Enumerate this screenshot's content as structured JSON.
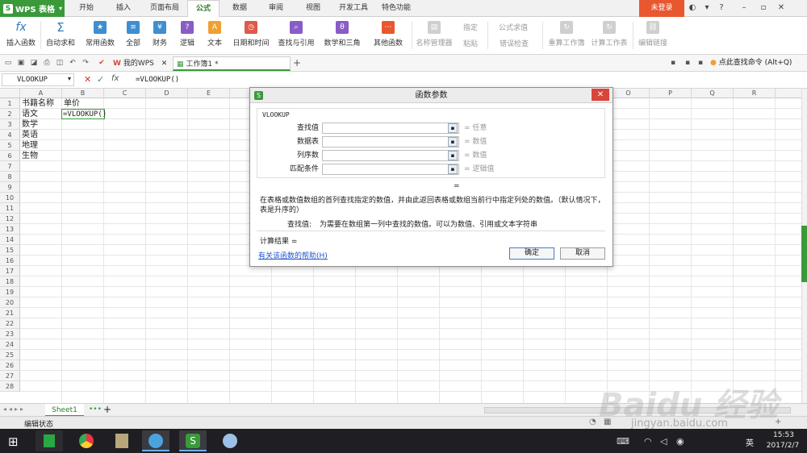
{
  "app": {
    "name": "WPS 表格"
  },
  "menu": {
    "tabs": [
      "开始",
      "插入",
      "页面布局",
      "公式",
      "数据",
      "审阅",
      "视图",
      "开发工具",
      "特色功能"
    ],
    "active": "公式",
    "login": "未登录"
  },
  "ribbon": {
    "items": [
      "插入函数",
      "自动求和",
      "常用函数",
      "全部",
      "财务",
      "逻辑",
      "文本",
      "日期和时间",
      "查找与引用",
      "数学和三角",
      "其他函数",
      "名称管理器",
      "指定",
      "粘贴",
      "公式求值",
      "错误检查",
      "重算工作簿",
      "计算工作表",
      "编辑链接"
    ],
    "icons": [
      "fx-icon",
      "sum-icon",
      "star-function-icon",
      "all-functions-icon",
      "finance-icon",
      "logic-icon",
      "text-icon",
      "datetime-icon",
      "lookup-icon",
      "math-icon",
      "other-function-icon",
      "name-manager-icon",
      "specify-icon",
      "paste-icon",
      "evaluate-icon",
      "error-check-icon",
      "recalc-book-icon",
      "recalc-sheet-icon",
      "edit-links-icon"
    ]
  },
  "doc_tabs": {
    "my_wps": "我的WPS",
    "workbook": "工作簿1 *"
  },
  "search_hint": "点此查找命令 (Alt+Q)",
  "formula_bar": {
    "name_box": "VLOOKUP",
    "formula": "=VLOOKUP()"
  },
  "grid": {
    "columns": [
      "A",
      "B",
      "C",
      "D",
      "E",
      "F",
      "G",
      "H",
      "I",
      "J",
      "K",
      "L",
      "M",
      "N",
      "O",
      "P",
      "Q",
      "R"
    ],
    "rows": [
      "1",
      "2",
      "3",
      "4",
      "5",
      "6",
      "7",
      "8",
      "9",
      "10",
      "11",
      "12",
      "13",
      "14",
      "15",
      "16",
      "17",
      "18",
      "19",
      "20",
      "21",
      "22",
      "23",
      "24",
      "25",
      "26",
      "27",
      "28"
    ],
    "cells": {
      "A1": "书籍名称",
      "B1": "单价",
      "A2": "语文",
      "B2": "=VLOOKUP()",
      "A3": "数学",
      "A4": "英语",
      "A5": "地理",
      "A6": "生物"
    }
  },
  "sheet_tab": "Sheet1",
  "status": {
    "mode": "编辑状态"
  },
  "dialog": {
    "title": "函数参数",
    "function_name": "VLOOKUP",
    "args": [
      {
        "label": "查找值",
        "result": "任意"
      },
      {
        "label": "数据表",
        "result": "数值"
      },
      {
        "label": "列序数",
        "result": "数值"
      },
      {
        "label": "匹配条件",
        "result": "逻辑值"
      }
    ],
    "equals": "=",
    "description": "在表格或数值数组的首列查找指定的数值，并由此返回表格或数组当前行中指定列处的数值。（默认情况下，表是升序的）",
    "arg_help_label": "查找值:",
    "arg_help_text": "为需要在数组第一列中查找的数值。可以为数值、引用或文本字符串",
    "result_label": "计算结果 =",
    "help_link": "有关该函数的帮助(H)",
    "ok": "确定",
    "cancel": "取消"
  },
  "watermark": {
    "text": "Baidu 经验",
    "url": "jingyan.baidu.com"
  },
  "taskbar": {
    "time": "15:53",
    "date": "2017/2/7",
    "ime": "英"
  },
  "colors": {
    "brand_green": "#3a9a3a",
    "login_orange": "#e9572f",
    "close_red": "#d9453a",
    "taskbar": "#1f1f23"
  }
}
